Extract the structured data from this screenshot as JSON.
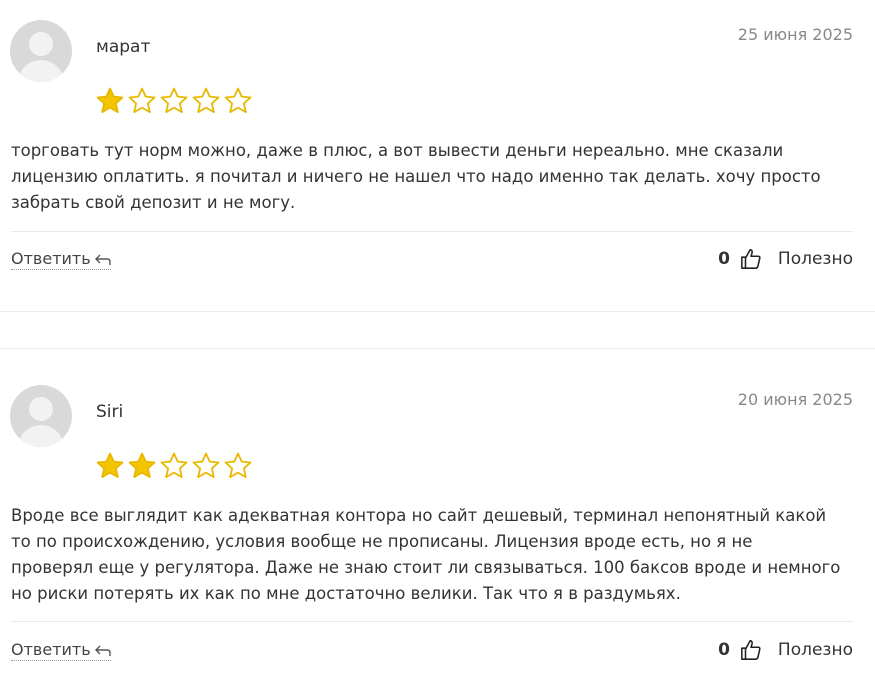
{
  "reviews": [
    {
      "author": "марат",
      "date": "25 июня 2025",
      "rating": 1,
      "max_rating": 5,
      "text": "торговать тут норм можно, даже в плюс, а вот вывести деньги нереально. мне сказали\nлицензию оплатить. я почитал и ничего не нашел что надо именно так делать. хочу просто\nзабрать свой депозит и не могу.",
      "reply_label": "Ответить",
      "helpful_count": "0",
      "helpful_label": "Полезно"
    },
    {
      "author": "Siri",
      "date": "20 июня 2025",
      "rating": 2,
      "max_rating": 5,
      "text": "Вроде все выглядит как адекватная контора но сайт дешевый, терминал непонятный какой\nто по происхождению, условия вообще не прописаны. Лицензия вроде есть, но я не\nпроверял еще у регулятора. Даже не знаю стоит ли связываться. 100 баксов вроде и немного\nно риски потерять их как по мне достаточно велики. Так что я в раздумьях.",
      "reply_label": "Ответить",
      "helpful_count": "0",
      "helpful_label": "Полезно"
    }
  ],
  "colors": {
    "star_filled": "#f2c500",
    "star_outline": "#e8b800",
    "date": "#888888",
    "avatar_bg": "#d9d9d9"
  },
  "icons": {
    "avatar": "default-user-avatar-icon",
    "star": "star-icon",
    "reply": "reply-arrow-icon",
    "helpful": "thumbs-up-icon"
  }
}
